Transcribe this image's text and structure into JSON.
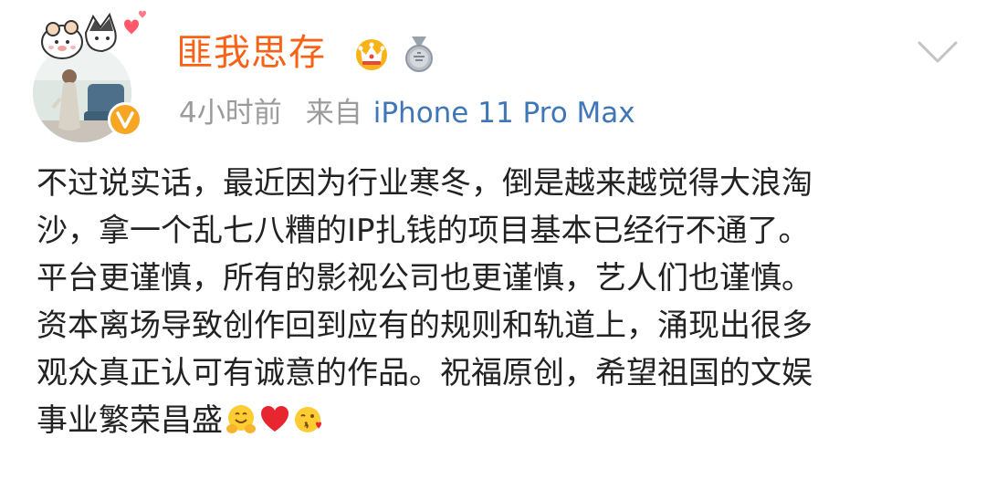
{
  "post": {
    "author": {
      "name": "匪我思存",
      "avatar_icon": "avatar-photo",
      "badges": [
        "crown-icon",
        "medal-icon"
      ],
      "verified_icon": "verified-v-icon"
    },
    "meta": {
      "time": "4小时前",
      "source_prefix": "来自",
      "device": "iPhone 11 Pro Max"
    },
    "body_lines": [
      "不过说实话，最近因为行业寒冬，倒是越来越觉得大浪淘",
      "沙，拿一个乱七八糟的IP扎钱的项目基本已经行不通了。",
      "平台更谨慎，所有的影视公司也更谨慎，艺人们也谨慎。",
      "资本离场导致创作回到应有的规则和轨道上，涌现出很多",
      "观众真正认可有诚意的作品。祝福原创，希望祖国的文娱",
      "事业繁荣昌盛"
    ],
    "trailing_emojis": [
      "hug-emoji",
      "red-heart-emoji",
      "blowing-kiss-emoji"
    ]
  },
  "colors": {
    "username": "#f86216",
    "device_link": "#3f76b8",
    "meta_gray": "#9b9b9b",
    "body_text": "#222222",
    "verified_badge": "#f6a623"
  }
}
